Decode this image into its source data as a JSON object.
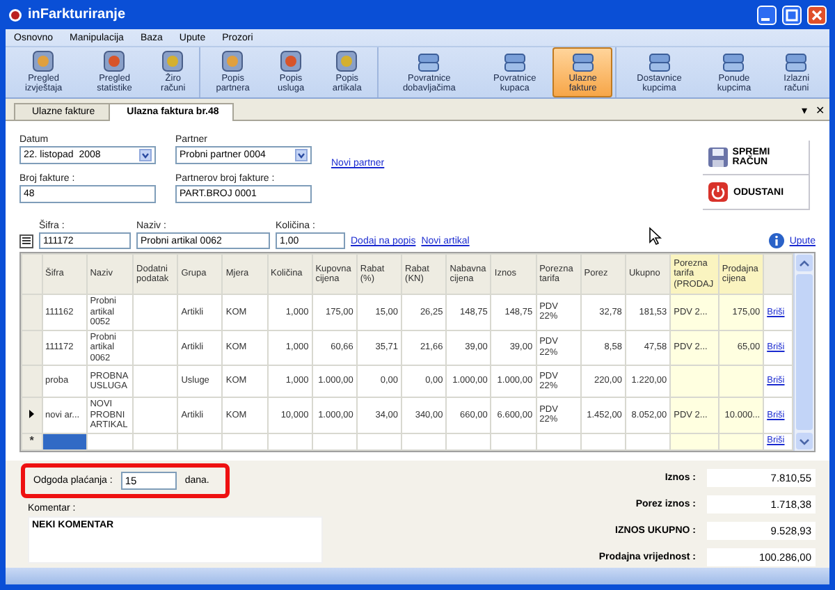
{
  "window": {
    "title": "inFarkturiranje"
  },
  "menu": [
    "Osnovno",
    "Manipulacija",
    "Baza",
    "Upute",
    "Prozori"
  ],
  "toolbar": [
    [
      {
        "label": "Pregled izvještaja",
        "selected": false
      },
      {
        "label": "Pregled statistike",
        "selected": false
      },
      {
        "label": "Žiro računi",
        "selected": false
      }
    ],
    [
      {
        "label": "Popis partnera",
        "selected": false
      },
      {
        "label": "Popis usluga",
        "selected": false
      },
      {
        "label": "Popis artikala",
        "selected": false
      }
    ],
    [
      {
        "label": "Povratnice dobavljačima",
        "selected": false
      },
      {
        "label": "Povratnice kupaca",
        "selected": false
      },
      {
        "label": "Ulazne fakture",
        "selected": true
      }
    ],
    [
      {
        "label": "Dostavnice kupcima",
        "selected": false
      },
      {
        "label": "Ponude kupcima",
        "selected": false
      },
      {
        "label": "Izlazni računi",
        "selected": false
      }
    ]
  ],
  "tabs": [
    {
      "label": "Ulazne fakture",
      "selected": false
    },
    {
      "label": "Ulazna faktura br.48",
      "selected": true
    }
  ],
  "tab_controls": [
    "▾",
    "✕"
  ],
  "header": {
    "date": {
      "label": "Datum",
      "value": "22. listopad  2008"
    },
    "partner": {
      "label": "Partner",
      "value": "Probni partner 0004"
    },
    "new_partner": "Novi partner",
    "invoice_no": {
      "label": "Broj fakture :",
      "value": "48"
    },
    "partner_invoice_no": {
      "label": "Partnerov broj fakture :",
      "value": "PART.BROJ 0001"
    }
  },
  "actions": [
    {
      "kind": "save",
      "label": "SPREMI RAČUN"
    },
    {
      "kind": "cancel",
      "label": "ODUSTANI"
    }
  ],
  "entry": {
    "code": {
      "label": "Šifra :",
      "value": "111172"
    },
    "name": {
      "label": "Naziv :",
      "value": "Probni artikal 0062"
    },
    "quantity": {
      "label": "Količina :",
      "value": "1,00"
    },
    "links": [
      "Dodaj na popis",
      "Novi artikal"
    ],
    "help": "Upute"
  },
  "table": {
    "columns": [
      {
        "label": "Šifra",
        "highlighted": false
      },
      {
        "label": "Naziv",
        "highlighted": false
      },
      {
        "label": "Dodatni podatak",
        "highlighted": false
      },
      {
        "label": "Grupa",
        "highlighted": false
      },
      {
        "label": "Mjera",
        "highlighted": false
      },
      {
        "label": "Količina",
        "highlighted": false
      },
      {
        "label": "Kupovna cijena",
        "highlighted": false
      },
      {
        "label": "Rabat (%)",
        "highlighted": false
      },
      {
        "label": "Rabat (KN)",
        "highlighted": false
      },
      {
        "label": "Nabavna cijena",
        "highlighted": false
      },
      {
        "label": "Iznos",
        "highlighted": false
      },
      {
        "label": "Porezna tarifa",
        "highlighted": false
      },
      {
        "label": "Porez",
        "highlighted": false
      },
      {
        "label": "Ukupno",
        "highlighted": false
      },
      {
        "label": "Porezna tarifa (PRODAJ",
        "highlighted": true
      },
      {
        "label": "Prodajna cijena",
        "highlighted": true
      }
    ],
    "rows": [
      {
        "kind": "data",
        "current": false,
        "cells": [
          "111162",
          "Probni artikal 0052",
          null,
          "Artikli",
          "KOM",
          "1,000",
          "175,00",
          "15,00",
          "26,25",
          "148,75",
          "148,75",
          "PDV 22%",
          "32,78",
          "181,53",
          "PDV 2...",
          "175,00"
        ],
        "action": "Briši"
      },
      {
        "kind": "data",
        "current": false,
        "cells": [
          "111172",
          "Probni artikal 0062",
          null,
          "Artikli",
          "KOM",
          "1,000",
          "60,66",
          "35,71",
          "21,66",
          "39,00",
          "39,00",
          "PDV 22%",
          "8,58",
          "47,58",
          "PDV 2...",
          "65,00"
        ],
        "action": "Briši"
      },
      {
        "kind": "data",
        "current": false,
        "cells": [
          "proba",
          "PROBNA USLUGA",
          null,
          "Usluge",
          "KOM",
          "1,000",
          "1.000,00",
          "0,00",
          "0,00",
          "1.000,00",
          "1.000,00",
          "PDV 22%",
          "220,00",
          "1.220,00",
          null,
          null
        ],
        "action": "Briši"
      },
      {
        "kind": "data",
        "current": true,
        "cells": [
          "novi ar...",
          "NOVI PROBNI ARTIKAL",
          null,
          "Artikli",
          "KOM",
          "10,000",
          "1.000,00",
          "34,00",
          "340,00",
          "660,00",
          "6.600,00",
          "PDV 22%",
          "1.452,00",
          "8.052,00",
          "PDV 2...",
          "10.000..."
        ],
        "action": "Briši"
      },
      {
        "kind": "new",
        "current": false,
        "marker": "*",
        "action": "Briši"
      }
    ]
  },
  "footer": {
    "payment_delay": {
      "label": "Odgoda plaćanja :",
      "value": "15",
      "unit": "dana.",
      "highlighted": true
    },
    "comment": {
      "label": "Komentar :",
      "value": "NEKI KOMENTAR"
    },
    "totals": [
      {
        "label": "Iznos :",
        "value": "7.810,55"
      },
      {
        "label": "Porez iznos :",
        "value": "1.718,38"
      },
      {
        "label": "IZNOS UKUPNO :",
        "value": "9.528,93"
      },
      {
        "label": "Prodajna vrijednost :",
        "value": "100.286,00"
      }
    ]
  }
}
